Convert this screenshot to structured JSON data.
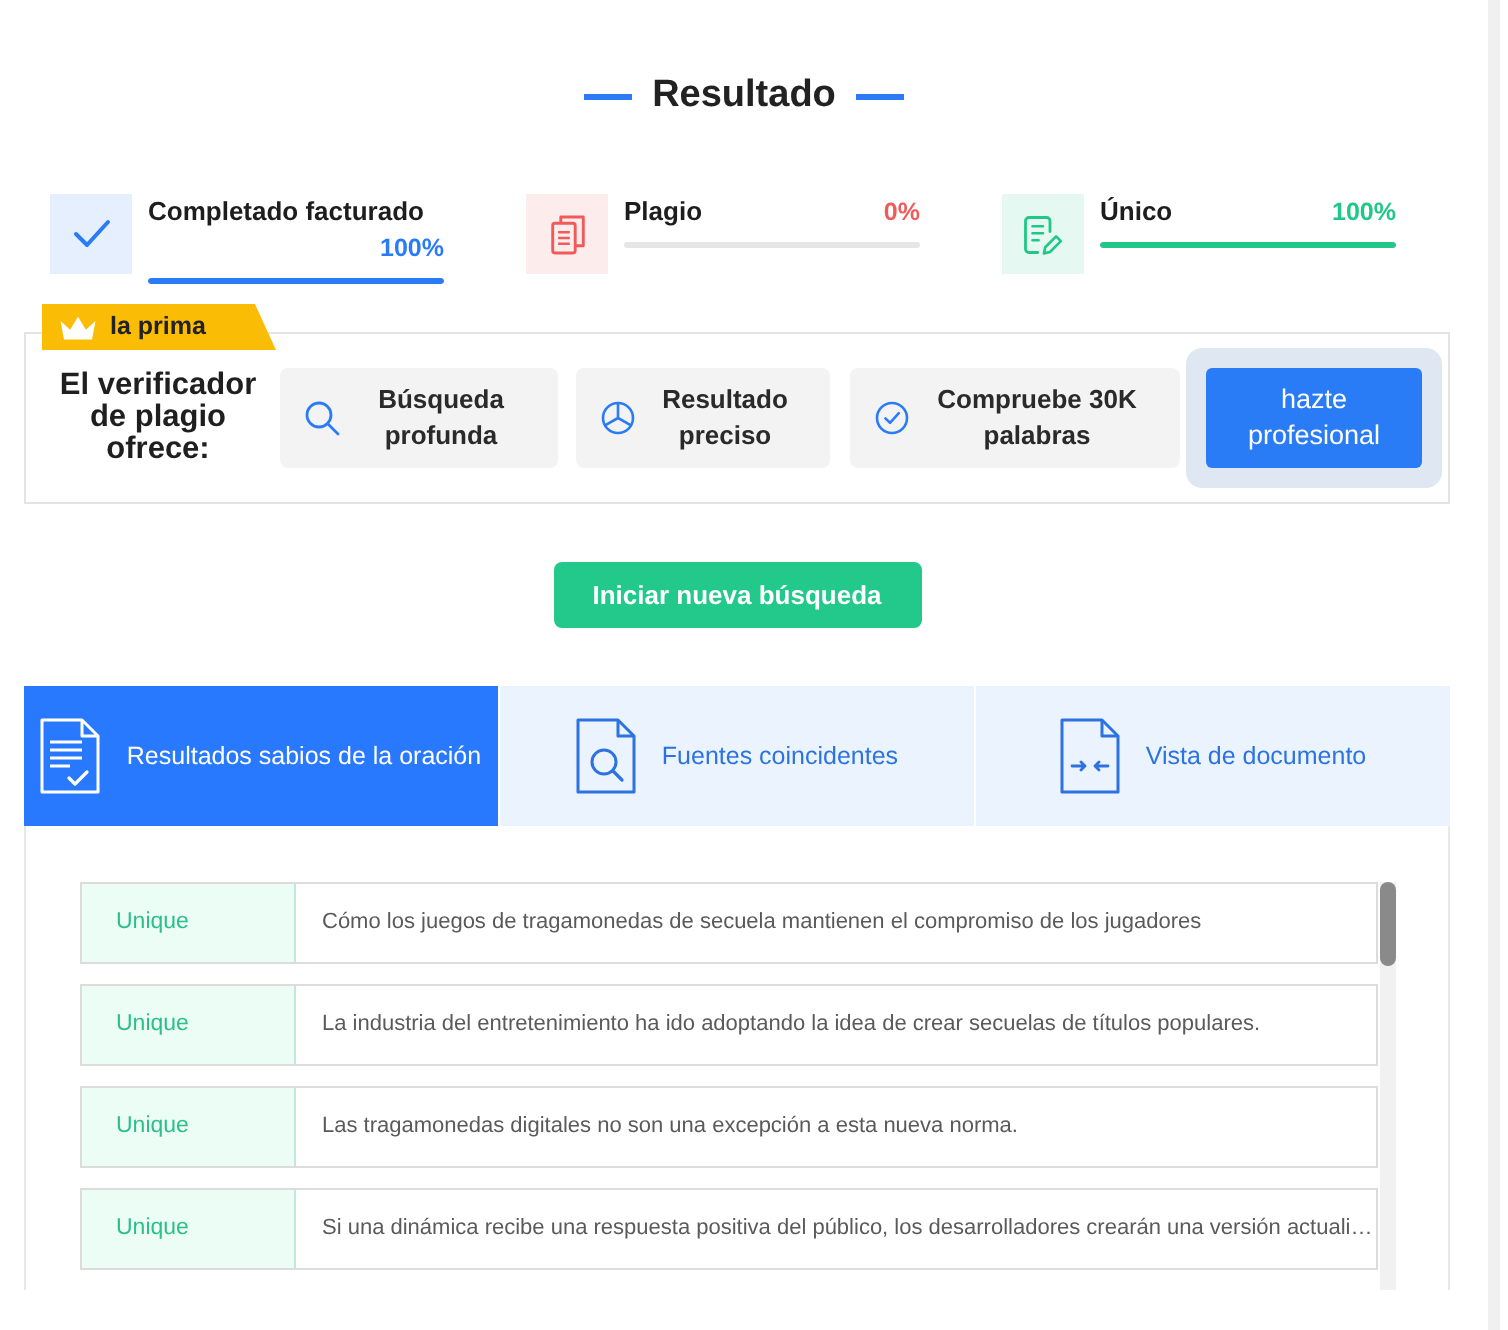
{
  "title": "Resultado",
  "stats": [
    {
      "kind": "billed",
      "label": "Completado facturado",
      "value": "100%",
      "level": 1,
      "color": "#2a7bf6"
    },
    {
      "kind": "plagiarism",
      "label": "Plagio",
      "value": "0%",
      "level": 0,
      "color": "#f05a5a"
    },
    {
      "kind": "unique",
      "label": "Único",
      "value": "100%",
      "level": 1,
      "color": "#21c786"
    }
  ],
  "premium": {
    "badge": "la prima",
    "heading": "El verificador de plagio ofrece:",
    "features": [
      {
        "kind": "search",
        "label": "Búsqueda profunda"
      },
      {
        "kind": "accuracy",
        "label": "Resultado preciso"
      },
      {
        "kind": "wordcount",
        "label": "Compruebe 30K palabras"
      }
    ],
    "upgrade_button": "hazte profesional"
  },
  "new_search_button": "Iniciar nueva búsqueda",
  "tabs": [
    {
      "kind": "sentences",
      "label": "Resultados sabios de la oración",
      "selected": true
    },
    {
      "kind": "sources",
      "label": "Fuentes coincidentes",
      "selected": false
    },
    {
      "kind": "document",
      "label": "Vista de documento",
      "selected": false
    }
  ],
  "results": [
    {
      "status": "Unique",
      "sentence": "Cómo los juegos de tragamonedas de secuela mantienen el compromiso de los jugadores"
    },
    {
      "status": "Unique",
      "sentence": "La industria del entretenimiento ha ido adoptando la idea de crear secuelas de títulos populares."
    },
    {
      "status": "Unique",
      "sentence": "Las tragamonedas digitales no son una excepción a esta nueva norma."
    },
    {
      "status": "Unique",
      "sentence": "Si una dinámica recibe una respuesta positiva del público, los desarrolladores crearán una versión actuali…"
    }
  ]
}
